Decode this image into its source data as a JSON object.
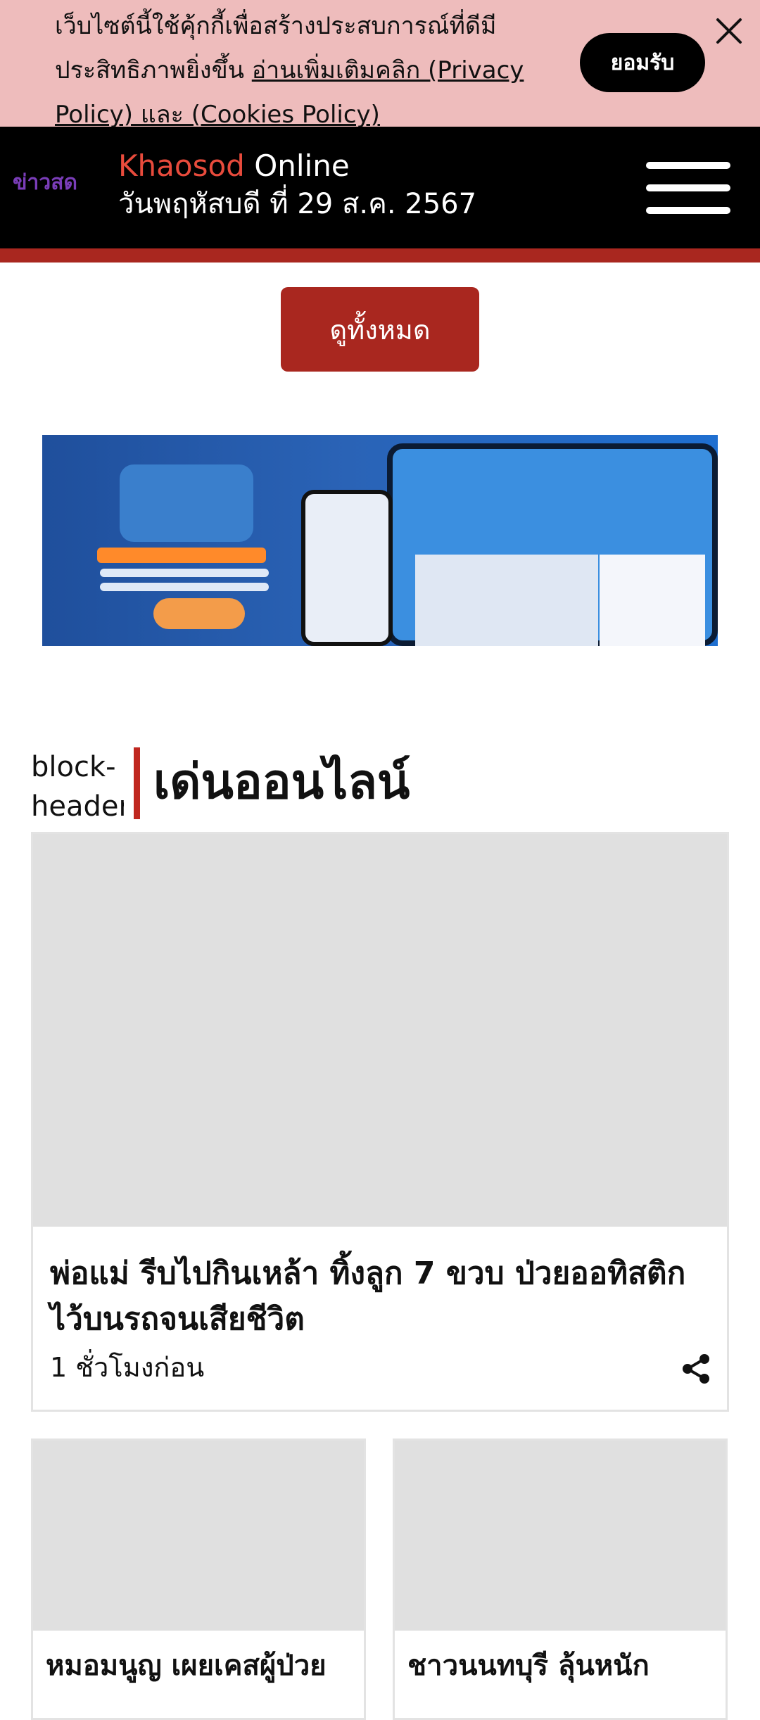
{
  "cookie_banner": {
    "line1": "เว็บไซต์นี้ใช้คุ้กกี้เพื่อสร้างประสบการณ์ที่ดีมี",
    "line2_prefix": "ประสิทธิภาพยิ่งขึ้น ",
    "link_text": "อ่านเพิ่มเติมคลิก (Privacy Policy) และ (Cookies Policy)",
    "accept_label": "ยอมรับ",
    "close_icon": "close-icon"
  },
  "header": {
    "logo_alt": "ข่าวสด",
    "brand_red": "Khaosod",
    "brand_white": "Online",
    "date": "วันพฤหัสบดี ที่ 29 ส.ค. 2567",
    "menu_icon": "hamburger-icon"
  },
  "view_all_label": "ดูทั้งหมด",
  "section": {
    "icon_alt": "block-header icon",
    "title": "เด่นออนไลน์"
  },
  "featured": {
    "headline": "พ่อแม่ รีบไปกินเหล้า ทิ้งลูก 7 ขวบ ป่วยออทิสติก ไว้บนรถจนเสียชีวิต",
    "time": "1 ชั่วโมงก่อน",
    "share_icon": "share-icon"
  },
  "cards": [
    {
      "headline": "หมอมนูญ เผยเคสผู้ป่วย"
    },
    {
      "headline": "ชาวนนทบุรี ลุ้นหนัก"
    }
  ],
  "colors": {
    "cookie_bg": "#eebcbc",
    "header_bg": "#000000",
    "accent_red": "#a9271f",
    "brand_red": "#e84b3c"
  }
}
